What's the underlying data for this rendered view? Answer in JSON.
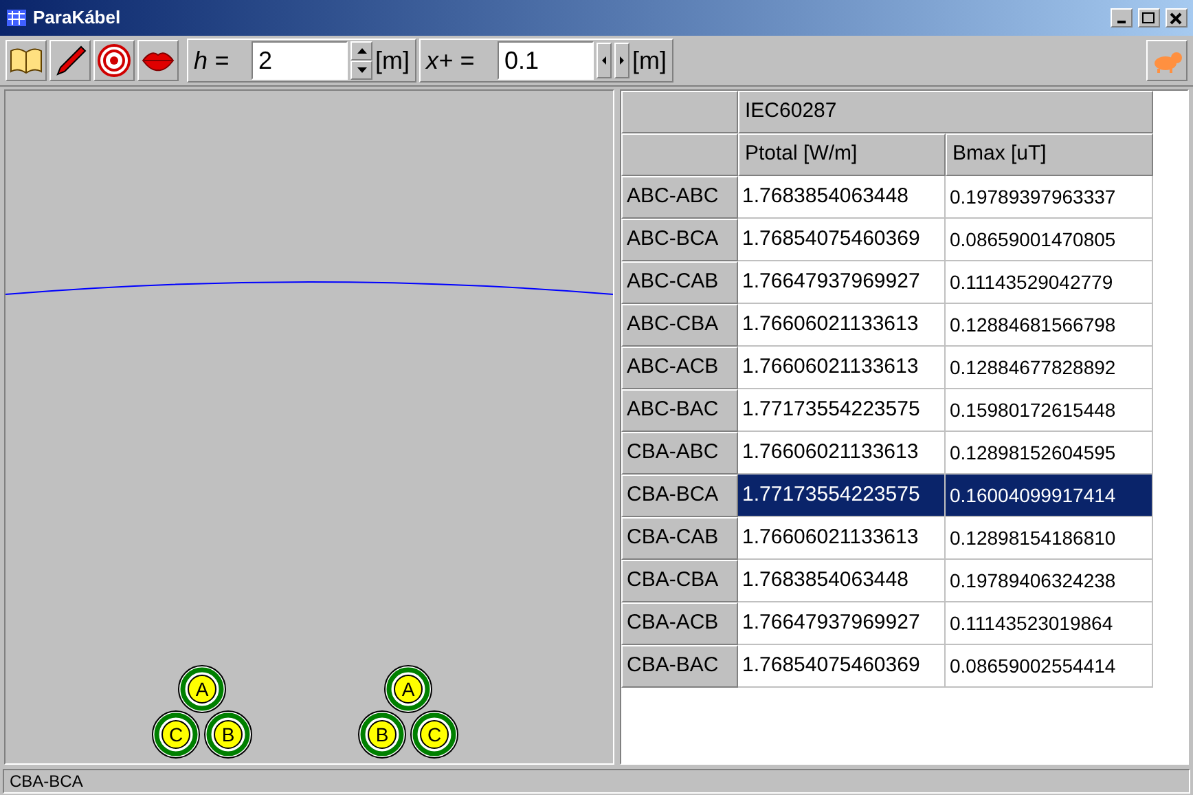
{
  "window": {
    "title": "ParaKábel"
  },
  "toolbar": {
    "h_label": "h =",
    "h_value": "2",
    "h_unit": "[m]",
    "x_label": "x+ =",
    "x_value": "0.1",
    "x_unit": "[m]"
  },
  "canvas": {
    "groups": [
      {
        "cables": [
          "A",
          "C",
          "B"
        ]
      },
      {
        "cables": [
          "A",
          "B",
          "C"
        ]
      }
    ]
  },
  "table": {
    "group_header": "IEC60287",
    "columns": [
      "Ptotal [W/m]",
      "Bmax [uT]"
    ],
    "rows": [
      {
        "label": "ABC-ABC",
        "ptotal": "1.7683854063448",
        "bmax": "0.19789397963337",
        "selected": false
      },
      {
        "label": "ABC-BCA",
        "ptotal": "1.76854075460369",
        "bmax": "0.08659001470805",
        "selected": false
      },
      {
        "label": "ABC-CAB",
        "ptotal": "1.76647937969927",
        "bmax": "0.11143529042779",
        "selected": false
      },
      {
        "label": "ABC-CBA",
        "ptotal": "1.76606021133613",
        "bmax": "0.12884681566798",
        "selected": false
      },
      {
        "label": "ABC-ACB",
        "ptotal": "1.76606021133613",
        "bmax": "0.12884677828892",
        "selected": false
      },
      {
        "label": "ABC-BAC",
        "ptotal": "1.77173554223575",
        "bmax": "0.15980172615448",
        "selected": false
      },
      {
        "label": "CBA-ABC",
        "ptotal": "1.76606021133613",
        "bmax": "0.12898152604595",
        "selected": false
      },
      {
        "label": "CBA-BCA",
        "ptotal": "1.77173554223575",
        "bmax": "0.16004099917414",
        "selected": true
      },
      {
        "label": "CBA-CAB",
        "ptotal": "1.76606021133613",
        "bmax": "0.12898154186810",
        "selected": false
      },
      {
        "label": "CBA-CBA",
        "ptotal": "1.7683854063448",
        "bmax": "0.19789406324238",
        "selected": false
      },
      {
        "label": "CBA-ACB",
        "ptotal": "1.76647937969927",
        "bmax": "0.11143523019864",
        "selected": false
      },
      {
        "label": "CBA-BAC",
        "ptotal": "1.76854075460369",
        "bmax": "0.08659002554414",
        "selected": false
      }
    ]
  },
  "status_bar": "CBA-BCA"
}
